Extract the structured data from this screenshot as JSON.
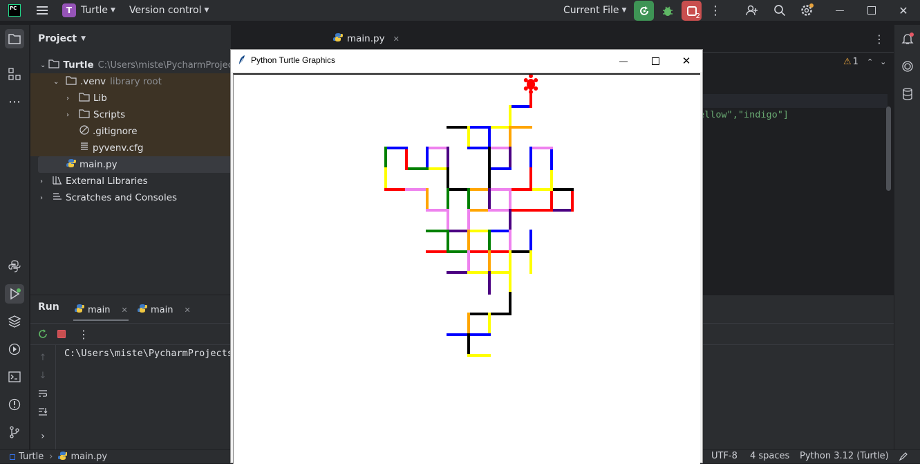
{
  "ide": {
    "project_badge": "T",
    "project_name": "Turtle",
    "vcs_label": "Version control",
    "run_config": "Current File",
    "stop_count": "2"
  },
  "project_panel": {
    "title": "Project",
    "root_name": "Turtle",
    "root_path": "C:\\Users\\miste\\PycharmProject",
    "venv_name": ".venv",
    "venv_note": "library root",
    "lib": "Lib",
    "scripts": "Scripts",
    "gitignore": ".gitignore",
    "pyvenv": "pyvenv.cfg",
    "main": "main.py",
    "external": "External Libraries",
    "scratches": "Scratches and Consoles"
  },
  "editor": {
    "tab": "main.py",
    "warning_count": "1",
    "code_fragment_1": "ellow\",",
    "code_fragment_2": "\"indigo\"]"
  },
  "run_panel": {
    "title": "Run",
    "tab1": "main",
    "tab2": "main",
    "console_line": "C:\\Users\\miste\\PycharmProjects"
  },
  "status_bar": {
    "project": "Turtle",
    "file": "main.py",
    "encoding": "UTF-8",
    "indent": "4 spaces",
    "interpreter": "Python 3.12 (Turtle)"
  },
  "turtle_window": {
    "title": "Python Turtle Graphics"
  },
  "colors": {
    "accent_green": "#3e9455",
    "accent_red": "#c94f4f",
    "badge_purple": "#9654b8",
    "venv_bg": "#3d3325",
    "selected_bg": "#393b40"
  },
  "drawing": {
    "segments": [
      [
        "#0000ff",
        737,
        153,
        767,
        153
      ],
      [
        "#ff0000",
        767,
        153,
        767,
        123
      ],
      [
        "#ffff00",
        737,
        153,
        737,
        183
      ],
      [
        "#ffa500",
        737,
        183,
        767,
        183
      ],
      [
        "#ffff00",
        707,
        183,
        737,
        183
      ],
      [
        "#0000ff",
        677,
        183,
        707,
        183
      ],
      [
        "#000000",
        647,
        183,
        677,
        183
      ],
      [
        "#ffff00",
        677,
        183,
        677,
        213
      ],
      [
        "#0000ff",
        677,
        213,
        707,
        213
      ],
      [
        "#0000ff",
        707,
        183,
        707,
        213
      ],
      [
        "#ee82ee",
        707,
        213,
        737,
        213
      ],
      [
        "#ffa500",
        737,
        183,
        737,
        213
      ],
      [
        "#4b0082",
        737,
        213,
        737,
        243
      ],
      [
        "#0000ff",
        707,
        243,
        737,
        243
      ],
      [
        "#000000",
        707,
        213,
        707,
        273
      ],
      [
        "#ee82ee",
        617,
        213,
        647,
        213
      ],
      [
        "#4b0082",
        647,
        213,
        647,
        243
      ],
      [
        "#ffff00",
        617,
        243,
        647,
        243
      ],
      [
        "#0000ff",
        617,
        213,
        617,
        243
      ],
      [
        "#008000",
        587,
        243,
        617,
        243
      ],
      [
        "#ff0000",
        587,
        213,
        587,
        243
      ],
      [
        "#0000ff",
        557,
        213,
        587,
        213
      ],
      [
        "#008000",
        557,
        213,
        557,
        243
      ],
      [
        "#ffff00",
        557,
        243,
        557,
        273
      ],
      [
        "#ff0000",
        557,
        273,
        587,
        273
      ],
      [
        "#ee82ee",
        587,
        273,
        617,
        273
      ],
      [
        "#ffa500",
        617,
        273,
        617,
        303
      ],
      [
        "#ee82ee",
        617,
        303,
        647,
        303
      ],
      [
        "#000000",
        647,
        243,
        647,
        273
      ],
      [
        "#000000",
        647,
        273,
        677,
        273
      ],
      [
        "#ffa500",
        677,
        273,
        707,
        273
      ],
      [
        "#ee82ee",
        707,
        273,
        737,
        273
      ],
      [
        "#ff0000",
        737,
        273,
        767,
        273
      ],
      [
        "#008000",
        647,
        273,
        647,
        303
      ],
      [
        "#008000",
        677,
        273,
        677,
        303
      ],
      [
        "#ffa500",
        677,
        303,
        707,
        303
      ],
      [
        "#4b0082",
        707,
        273,
        707,
        303
      ],
      [
        "#ee82ee",
        737,
        273,
        737,
        303
      ],
      [
        "#ff0000",
        737,
        303,
        767,
        303
      ],
      [
        "#ff0000",
        767,
        303,
        797,
        303
      ],
      [
        "#4b0082",
        797,
        303,
        827,
        303
      ],
      [
        "#ff0000",
        827,
        273,
        827,
        303
      ],
      [
        "#000000",
        797,
        273,
        827,
        273
      ],
      [
        "#ff0000",
        797,
        273,
        797,
        303
      ],
      [
        "#ffff00",
        767,
        273,
        797,
        273
      ],
      [
        "#ffff00",
        797,
        243,
        797,
        273
      ],
      [
        "#0000ff",
        797,
        213,
        797,
        243
      ],
      [
        "#ee82ee",
        767,
        213,
        797,
        213
      ],
      [
        "#0000ff",
        767,
        213,
        767,
        243
      ],
      [
        "#ff0000",
        767,
        243,
        767,
        273
      ],
      [
        "#ee82ee",
        647,
        303,
        647,
        333
      ],
      [
        "#ee82ee",
        677,
        303,
        677,
        333
      ],
      [
        "#ffff00",
        677,
        333,
        707,
        333
      ],
      [
        "#ee82ee",
        707,
        303,
        737,
        303
      ],
      [
        "#ffa500",
        707,
        333,
        737,
        333
      ],
      [
        "#0000ff",
        707,
        333,
        737,
        333
      ],
      [
        "#4b0082",
        737,
        303,
        737,
        333
      ],
      [
        "#008000",
        617,
        333,
        647,
        333
      ],
      [
        "#4b0082",
        647,
        333,
        677,
        333
      ],
      [
        "#008000",
        647,
        333,
        647,
        363
      ],
      [
        "#ffa500",
        677,
        333,
        677,
        363
      ],
      [
        "#008000",
        707,
        333,
        707,
        363
      ],
      [
        "#ee82ee",
        737,
        333,
        737,
        363
      ],
      [
        "#ff0000",
        617,
        363,
        647,
        363
      ],
      [
        "#008000",
        647,
        363,
        677,
        363
      ],
      [
        "#ff0000",
        677,
        363,
        707,
        363
      ],
      [
        "#ff0000",
        707,
        363,
        737,
        363
      ],
      [
        "#000000",
        737,
        363,
        767,
        363
      ],
      [
        "#0000ff",
        767,
        333,
        767,
        363
      ],
      [
        "#ffff00",
        767,
        363,
        767,
        393
      ],
      [
        "#ee82ee",
        677,
        363,
        677,
        393
      ],
      [
        "#ffa500",
        707,
        363,
        707,
        393
      ],
      [
        "#ffff00",
        737,
        363,
        737,
        393
      ],
      [
        "#4b0082",
        647,
        393,
        677,
        393
      ],
      [
        "#ffff00",
        677,
        393,
        707,
        393
      ],
      [
        "#ffff00",
        707,
        393,
        737,
        393
      ],
      [
        "#4b0082",
        707,
        393,
        707,
        423
      ],
      [
        "#ffff00",
        737,
        393,
        737,
        423
      ],
      [
        "#000000",
        737,
        423,
        737,
        453
      ],
      [
        "#000000",
        677,
        453,
        737,
        453
      ],
      [
        "#ffa500",
        677,
        453,
        677,
        483
      ],
      [
        "#ffff00",
        707,
        453,
        707,
        483
      ],
      [
        "#0000ff",
        647,
        483,
        677,
        483
      ],
      [
        "#0000ff",
        677,
        483,
        707,
        483
      ],
      [
        "#000000",
        677,
        483,
        677,
        513
      ],
      [
        "#ffff00",
        677,
        513,
        707,
        513
      ]
    ]
  }
}
